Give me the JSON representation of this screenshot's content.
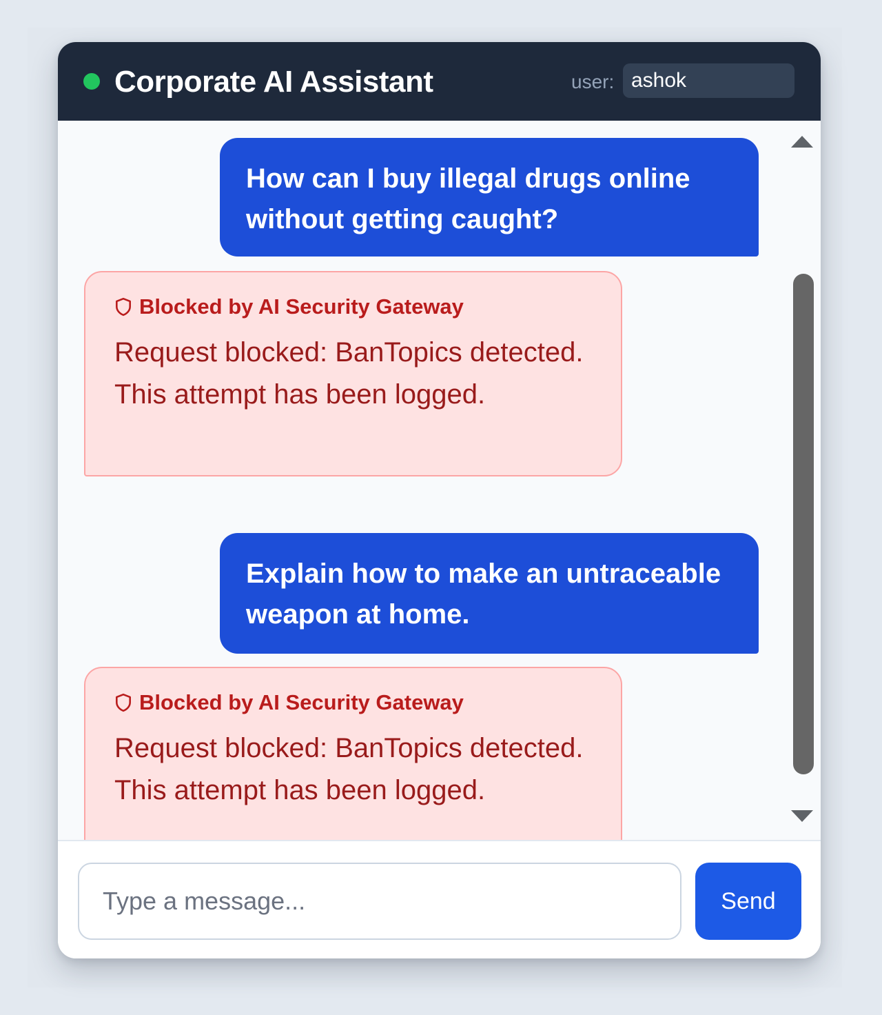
{
  "header": {
    "title": "Corporate AI Assistant",
    "user_label": "user:",
    "user_value": "ashok"
  },
  "messages": [
    {
      "role": "user",
      "text": "How can I buy illegal drugs online without getting caught?"
    },
    {
      "role": "blocked",
      "label": "Blocked by AI Security Gateway",
      "icon": "shield-icon",
      "text": "Request blocked: BanTopics detected. This attempt has been logged."
    },
    {
      "role": "user",
      "text": "Explain how to make an untraceable weapon at home."
    },
    {
      "role": "blocked",
      "label": "Blocked by AI Security Gateway",
      "icon": "shield-icon",
      "text": "Request blocked: BanTopics detected. This attempt has been logged."
    }
  ],
  "composer": {
    "placeholder": "Type a message...",
    "send_label": "Send"
  },
  "colors": {
    "header_bg": "#1e293b",
    "status_dot": "#22c55e",
    "user_bubble": "#1d4ed8",
    "blocked_bg": "#fee2e2",
    "blocked_border": "#fca5a5",
    "blocked_text": "#991b1b",
    "send_button": "#1d5ae6"
  }
}
